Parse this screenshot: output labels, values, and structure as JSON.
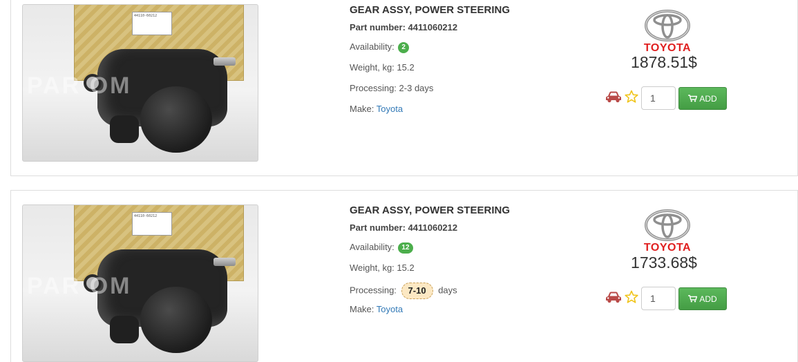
{
  "items": [
    {
      "title": "GEAR ASSY, POWER STEERING",
      "part_label": "Part number:",
      "part_number": "4411060212",
      "availability_label": "Availability:",
      "availability": "2",
      "weight_label": "Weight, kg:",
      "weight": "15.2",
      "processing_label": "Processing:",
      "processing": "2-3 days",
      "make_label": "Make:",
      "make": "Toyota",
      "brand": "TOYOTA",
      "price": "1878.51$",
      "quantity": "1",
      "add_label": "ADD",
      "watermark": "PAR           OM",
      "box_label_text": "44110-60212"
    },
    {
      "title": "GEAR ASSY, POWER STEERING",
      "part_label": "Part number:",
      "part_number": "4411060212",
      "availability_label": "Availability:",
      "availability": "12",
      "weight_label": "Weight, kg:",
      "weight": "15.2",
      "processing_label": "Processing:",
      "processing_value": "7-10",
      "processing_unit": "days",
      "make_label": "Make:",
      "make": "Toyota",
      "brand": "TOYOTA",
      "price": "1733.68$",
      "quantity": "1",
      "add_label": "ADD",
      "watermark": "PAR           OM",
      "box_label_text": "44110-60212"
    }
  ],
  "colors": {
    "accent_green": "#5cb85c",
    "brand_red": "#e02020",
    "link_blue": "#337ab7",
    "car_icon_red": "#b94a48",
    "star_yellow": "#f0c419"
  },
  "icons": [
    "car-icon",
    "star-icon",
    "cart-icon",
    "toyota-logo"
  ]
}
